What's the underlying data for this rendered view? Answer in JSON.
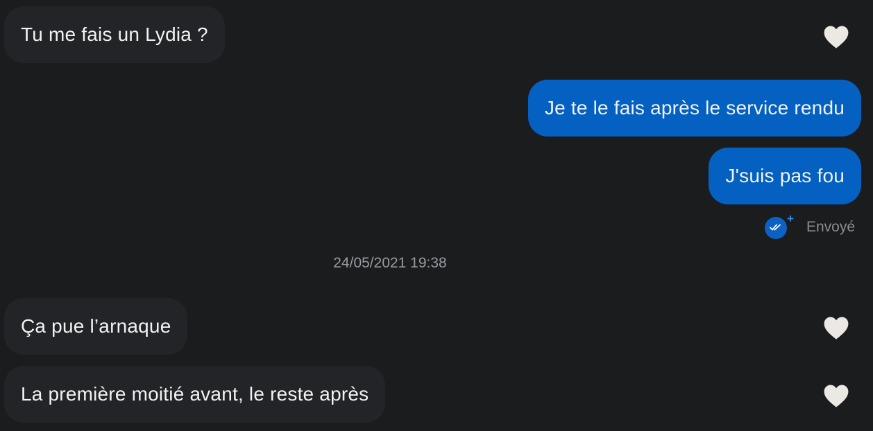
{
  "messages": {
    "m1": {
      "text": "Tu me fais un Lydia ?",
      "direction": "received",
      "liked": true
    },
    "m2": {
      "text": "Je te le fais après le service rendu",
      "direction": "sent"
    },
    "m3": {
      "text": "J'suis pas fou",
      "direction": "sent"
    },
    "m4": {
      "text": "Ça pue l’arnaque",
      "direction": "received",
      "liked": true
    },
    "m5": {
      "text": "La première moitié avant, le reste après",
      "direction": "received",
      "liked": true
    }
  },
  "status": {
    "label": "Envoyé",
    "icon": "double-check-icon"
  },
  "timestamp": "24/05/2021 19:38",
  "colors": {
    "background": "#1b1c1e",
    "received_bubble": "#222427",
    "sent_bubble": "#0460c1",
    "heart": "#ece8e3",
    "status_accent": "#0b62c4"
  }
}
